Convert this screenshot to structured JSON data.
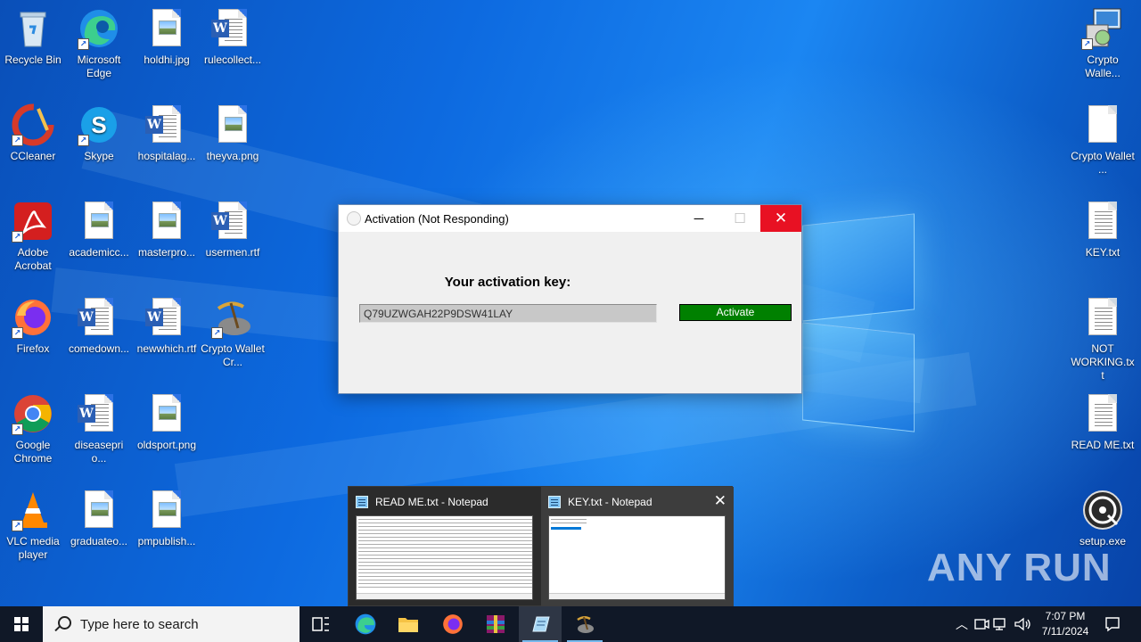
{
  "desktop": {
    "icons_left": [
      {
        "name": "recycle-bin-icon",
        "label": "Recycle Bin"
      },
      {
        "name": "edge-icon",
        "label": "Microsoft Edge"
      },
      {
        "name": "image-file-icon",
        "label": "holdhi.jpg"
      },
      {
        "name": "word-file-icon",
        "label": "rulecollect..."
      },
      {
        "name": "ccleaner-icon",
        "label": "CCleaner"
      },
      {
        "name": "skype-icon",
        "label": "Skype"
      },
      {
        "name": "word-file-icon",
        "label": "hospitalag..."
      },
      {
        "name": "image-file-icon",
        "label": "theyva.png"
      },
      {
        "name": "adobe-acrobat-icon",
        "label": "Adobe Acrobat"
      },
      {
        "name": "image-file-icon",
        "label": "academicc..."
      },
      {
        "name": "image-file-icon",
        "label": "masterpro..."
      },
      {
        "name": "word-file-icon",
        "label": "usermen.rtf"
      },
      {
        "name": "firefox-icon",
        "label": "Firefox"
      },
      {
        "name": "word-file-icon",
        "label": "comedown..."
      },
      {
        "name": "word-file-icon",
        "label": "newwhich.rtf"
      },
      {
        "name": "crypto-wallet-cr-icon",
        "label": "Crypto Wallet Cr..."
      },
      {
        "name": "chrome-icon",
        "label": "Google Chrome"
      },
      {
        "name": "word-file-icon",
        "label": "diseasepri o..."
      },
      {
        "name": "image-file-icon",
        "label": "oldsport.png"
      },
      {
        "name": "vlc-icon",
        "label": "VLC media player"
      },
      {
        "name": "image-file-icon",
        "label": "graduateo..."
      },
      {
        "name": "image-file-icon",
        "label": "pmpublish..."
      }
    ],
    "icons_right": [
      {
        "name": "installer-icon",
        "label": "Crypto Walle..."
      },
      {
        "name": "blank-file-icon",
        "label": "Crypto Wallet ..."
      },
      {
        "name": "text-file-icon",
        "label": "KEY.txt"
      },
      {
        "name": "text-file-icon",
        "label": "NOT WORKING.txt"
      },
      {
        "name": "text-file-icon",
        "label": "READ ME.txt"
      },
      {
        "name": "disc-setup-icon",
        "label": "setup.exe"
      }
    ]
  },
  "activation_window": {
    "title": "Activation (Not Responding)",
    "minimize": "─",
    "maximize": "☐",
    "close": "✕",
    "heading": "Your activation key:",
    "key_value": "Q79UZWGAH22P9DSW41LAY",
    "activate_label": "Activate",
    "activate_color": "#008000"
  },
  "thumbnails": [
    {
      "title": "READ ME.txt - Notepad"
    },
    {
      "title": "KEY.txt - Notepad",
      "close": "✕"
    }
  ],
  "watermark": "ANY RUN",
  "taskbar": {
    "search_placeholder": "Type here to search",
    "clock_time": "7:07 PM",
    "clock_date": "7/11/2024"
  },
  "colors": {
    "taskbar_bg": "#101827",
    "close_red": "#e81123",
    "accent": "#0078d7"
  }
}
